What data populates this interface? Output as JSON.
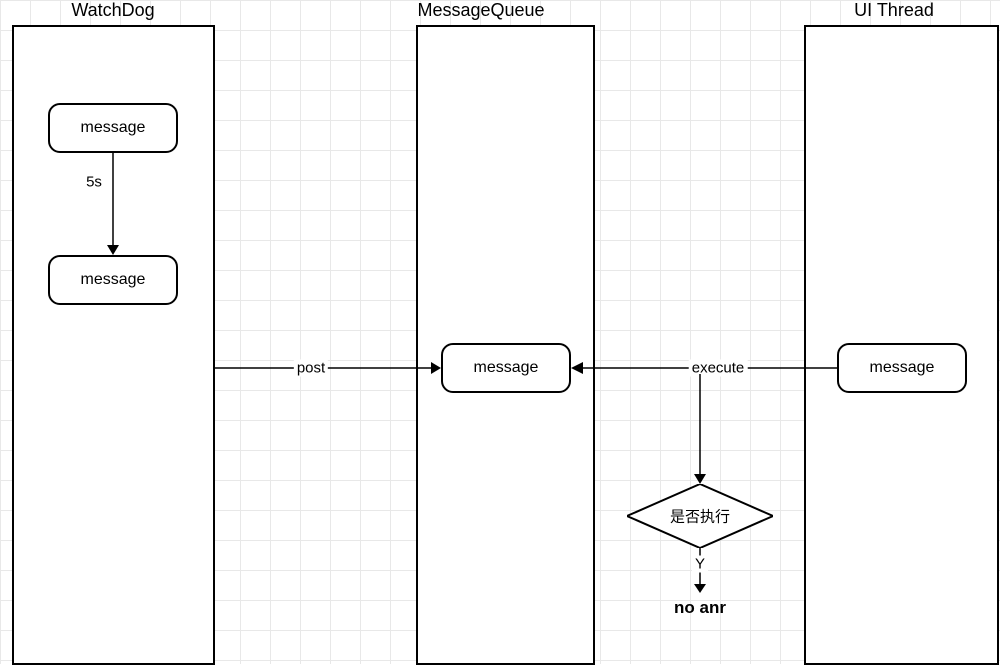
{
  "columns": {
    "watchdog": {
      "title": "WatchDog"
    },
    "messagequeue": {
      "title": "MessageQueue"
    },
    "uithread": {
      "title": "UI Thread"
    }
  },
  "boxes": {
    "wd_msg1": "message",
    "wd_msg2": "message",
    "mq_msg": "message",
    "ui_msg": "message"
  },
  "labels": {
    "interval": "5s",
    "post": "post",
    "execute": "execute",
    "decision": "是否执行",
    "yes": "Y"
  },
  "result": {
    "noanr": "no anr"
  }
}
